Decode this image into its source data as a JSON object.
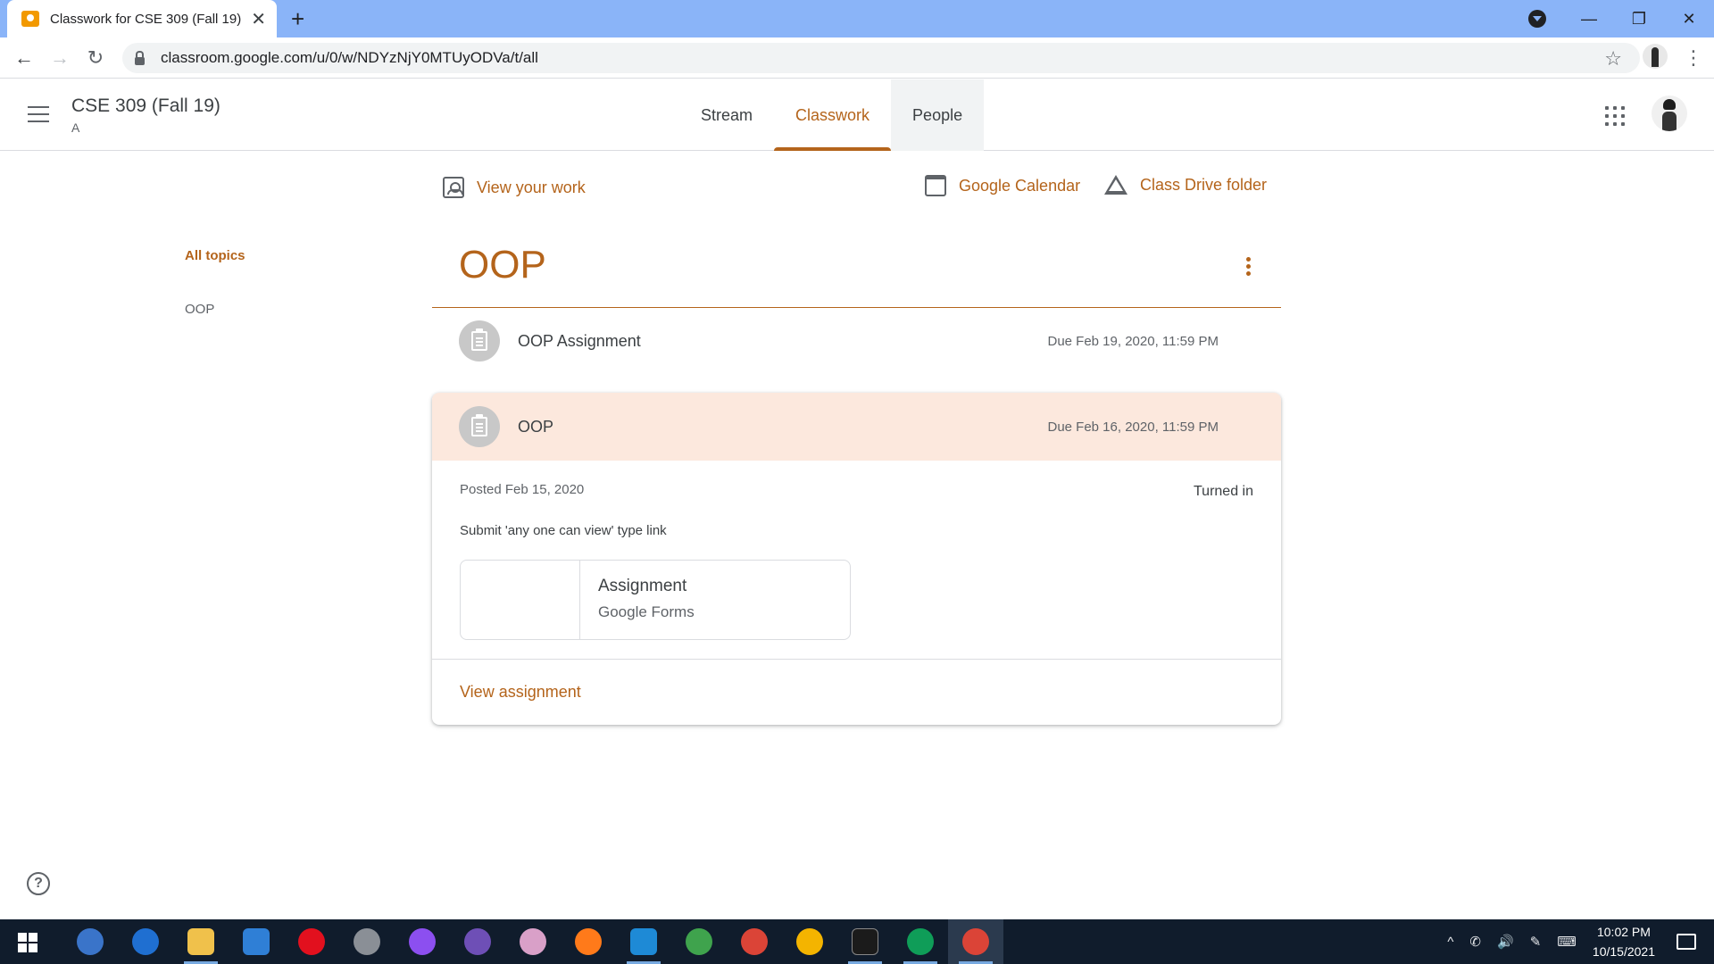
{
  "browser": {
    "tab_title": "Classwork for CSE 309 (Fall 19) A",
    "tab_close": "✕",
    "new_tab": "+",
    "url": "classroom.google.com/u/0/w/NDYzNjY0MTUyODVa/t/all",
    "back": "←",
    "forward": "→",
    "reload": "↻",
    "star": "☆",
    "menu": "⋮",
    "minimize": "—",
    "restore": "❐",
    "close": "✕"
  },
  "header": {
    "course_title": "CSE 309 (Fall 19)",
    "course_section": "A",
    "tabs": [
      {
        "label": "Stream"
      },
      {
        "label": "Classwork"
      },
      {
        "label": "People"
      }
    ]
  },
  "actions": {
    "view_work": "View your work",
    "calendar": "Google Calendar",
    "drive": "Class Drive folder"
  },
  "topics_nav": {
    "all_topics": "All topics",
    "items": [
      "OOP"
    ]
  },
  "topic": {
    "title": "OOP",
    "items": [
      {
        "title": "OOP Assignment",
        "due": "Due Feb 19, 2020, 11:59 PM"
      },
      {
        "title": "OOP",
        "due": "Due Feb 16, 2020, 11:59 PM",
        "posted": "Posted Feb 15, 2020",
        "status": "Turned in",
        "instructions": "Submit 'any one can view' type link",
        "attachment": {
          "title": "Assignment",
          "type": "Google Forms"
        },
        "view_link": "View assignment"
      }
    ]
  },
  "help": "?",
  "taskbar": {
    "apps": [
      "qbittorrent-icon",
      "edge-icon",
      "file-explorer-icon",
      "mail-icon",
      "opera-icon",
      "satellite-icon",
      "messenger-icon",
      "github-icon",
      "paint-icon",
      "firefox-icon",
      "vscode-icon",
      "earth-icon",
      "chrome-profile-icon",
      "chrome-icon",
      "terminal-icon",
      "chrome-ek-icon",
      "chrome-active-icon"
    ],
    "tray_glyphs": [
      "^",
      "✆",
      "🔊",
      "✎",
      "⌨"
    ],
    "time": "10:02 PM",
    "date": "10/15/2021"
  },
  "colors": {
    "accent": "#b4641b",
    "tab_bar": "#8ab4f8",
    "highlight_row": "#fce8dd",
    "taskbar": "#101c2c"
  }
}
